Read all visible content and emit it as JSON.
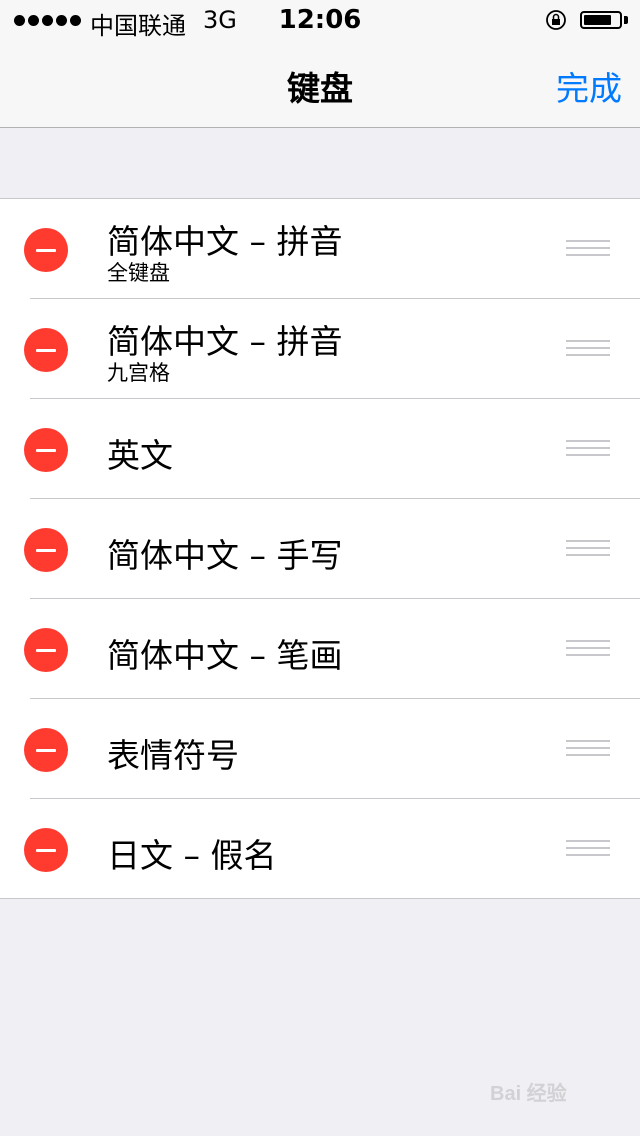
{
  "status_bar": {
    "carrier": "中国联通",
    "network": "3G",
    "time": "12:06",
    "battery_level": 0.8
  },
  "nav": {
    "title": "键盘",
    "done_label": "完成"
  },
  "keyboards": [
    {
      "title": "简体中文 – 拼音",
      "subtitle": "全键盘"
    },
    {
      "title": "简体中文 – 拼音",
      "subtitle": "九宫格"
    },
    {
      "title": "英文"
    },
    {
      "title": "简体中文 – 手写"
    },
    {
      "title": "简体中文 – 笔画"
    },
    {
      "title": "表情符号"
    },
    {
      "title": "日文 – 假名"
    }
  ],
  "colors": {
    "accent": "#007aff",
    "delete": "#ff3b30",
    "background": "#efeff4"
  }
}
